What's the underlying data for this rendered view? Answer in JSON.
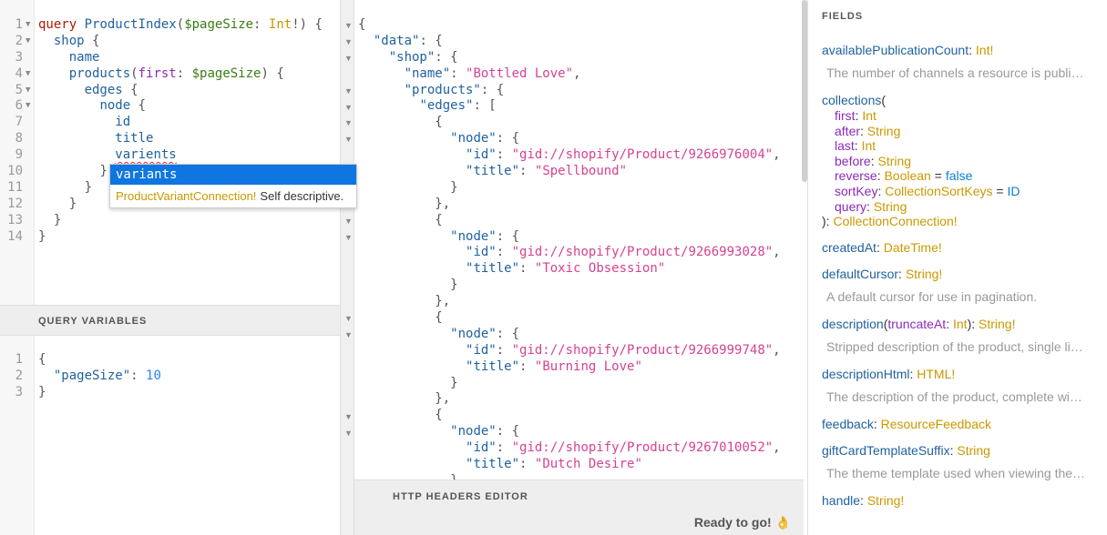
{
  "query_editor": {
    "lines": [
      {
        "n": "1",
        "fold": true
      },
      {
        "n": "2",
        "fold": true
      },
      {
        "n": "3",
        "fold": false
      },
      {
        "n": "4",
        "fold": true
      },
      {
        "n": "5",
        "fold": true
      },
      {
        "n": "6",
        "fold": true
      },
      {
        "n": "7",
        "fold": false
      },
      {
        "n": "8",
        "fold": false
      },
      {
        "n": "9",
        "fold": false
      },
      {
        "n": "10",
        "fold": false
      },
      {
        "n": "11",
        "fold": false
      },
      {
        "n": "12",
        "fold": false
      },
      {
        "n": "13",
        "fold": false
      },
      {
        "n": "14",
        "fold": false
      }
    ],
    "t1_kw": "query",
    "t1_name": "ProductIndex",
    "t1_open": "(",
    "t1_var": "$pageSize",
    "t1_colon": ": ",
    "t1_type": "Int",
    "t1_close": "!) {",
    "t2_field": "shop",
    "t2_brace": " {",
    "t3_field": "name",
    "t4_field": "products",
    "t4_open": "(",
    "t4_arg": "first",
    "t4_colon": ": ",
    "t4_var": "$pageSize",
    "t4_close": ") {",
    "t5_field": "edges",
    "t5_brace": " {",
    "t6_field": "node",
    "t6_brace": " {",
    "t7_field": "id",
    "t8_field": "title",
    "t9_field": "varients",
    "t10": "}",
    "t11": "}",
    "t12": "}",
    "t13": "}",
    "t14": "}"
  },
  "autocomplete": {
    "selected": "variants",
    "type": "ProductVariantConnection!",
    "description": "Self descriptive."
  },
  "variables": {
    "header": "QUERY VARIABLES",
    "l1": "{",
    "key": "\"pageSize\"",
    "colon": ": ",
    "value": "10",
    "l3": "}",
    "numbers": [
      "1",
      "2",
      "3"
    ]
  },
  "result": {
    "lines": [
      {
        "parts": [
          [
            "{",
            "pun"
          ]
        ],
        "fold": true
      },
      {
        "parts": [
          [
            "  ",
            ""
          ],
          [
            "\"data\"",
            "jkey"
          ],
          [
            ": {",
            "pun"
          ]
        ],
        "fold": true
      },
      {
        "parts": [
          [
            "    ",
            ""
          ],
          [
            "\"shop\"",
            "jkey"
          ],
          [
            ": {",
            "pun"
          ]
        ],
        "fold": true
      },
      {
        "parts": [
          [
            "      ",
            ""
          ],
          [
            "\"name\"",
            "jkey"
          ],
          [
            ": ",
            "pun"
          ],
          [
            "\"Bottled Love\"",
            "str"
          ],
          [
            ",",
            "pun"
          ]
        ],
        "fold": false
      },
      {
        "parts": [
          [
            "      ",
            ""
          ],
          [
            "\"products\"",
            "jkey"
          ],
          [
            ": {",
            "pun"
          ]
        ],
        "fold": true
      },
      {
        "parts": [
          [
            "        ",
            ""
          ],
          [
            "\"edges\"",
            "jkey"
          ],
          [
            ": [",
            "pun"
          ]
        ],
        "fold": true
      },
      {
        "parts": [
          [
            "          ",
            ""
          ],
          [
            "{",
            "pun"
          ]
        ],
        "fold": true
      },
      {
        "parts": [
          [
            "            ",
            ""
          ],
          [
            "\"node\"",
            "jkey"
          ],
          [
            ": {",
            "pun"
          ]
        ],
        "fold": true
      },
      {
        "parts": [
          [
            "              ",
            ""
          ],
          [
            "\"id\"",
            "jkey"
          ],
          [
            ": ",
            "pun"
          ],
          [
            "\"gid://shopify/Product/9266976004\"",
            "str"
          ],
          [
            ",",
            "pun"
          ]
        ],
        "fold": false
      },
      {
        "parts": [
          [
            "              ",
            ""
          ],
          [
            "\"title\"",
            "jkey"
          ],
          [
            ": ",
            "pun"
          ],
          [
            "\"Spellbound\"",
            "str"
          ]
        ],
        "fold": false
      },
      {
        "parts": [
          [
            "            ",
            ""
          ],
          [
            "}",
            "pun"
          ]
        ],
        "fold": false
      },
      {
        "parts": [
          [
            "          ",
            ""
          ],
          [
            "},",
            "pun"
          ]
        ],
        "fold": false
      },
      {
        "parts": [
          [
            "          ",
            ""
          ],
          [
            "{",
            "pun"
          ]
        ],
        "fold": true
      },
      {
        "parts": [
          [
            "            ",
            ""
          ],
          [
            "\"node\"",
            "jkey"
          ],
          [
            ": {",
            "pun"
          ]
        ],
        "fold": true
      },
      {
        "parts": [
          [
            "              ",
            ""
          ],
          [
            "\"id\"",
            "jkey"
          ],
          [
            ": ",
            "pun"
          ],
          [
            "\"gid://shopify/Product/9266993028\"",
            "str"
          ],
          [
            ",",
            "pun"
          ]
        ],
        "fold": false
      },
      {
        "parts": [
          [
            "              ",
            ""
          ],
          [
            "\"title\"",
            "jkey"
          ],
          [
            ": ",
            "pun"
          ],
          [
            "\"Toxic Obsession\"",
            "str"
          ]
        ],
        "fold": false
      },
      {
        "parts": [
          [
            "            ",
            ""
          ],
          [
            "}",
            "pun"
          ]
        ],
        "fold": false
      },
      {
        "parts": [
          [
            "          ",
            ""
          ],
          [
            "},",
            "pun"
          ]
        ],
        "fold": false
      },
      {
        "parts": [
          [
            "          ",
            ""
          ],
          [
            "{",
            "pun"
          ]
        ],
        "fold": true
      },
      {
        "parts": [
          [
            "            ",
            ""
          ],
          [
            "\"node\"",
            "jkey"
          ],
          [
            ": {",
            "pun"
          ]
        ],
        "fold": true
      },
      {
        "parts": [
          [
            "              ",
            ""
          ],
          [
            "\"id\"",
            "jkey"
          ],
          [
            ": ",
            "pun"
          ],
          [
            "\"gid://shopify/Product/9266999748\"",
            "str"
          ],
          [
            ",",
            "pun"
          ]
        ],
        "fold": false
      },
      {
        "parts": [
          [
            "              ",
            ""
          ],
          [
            "\"title\"",
            "jkey"
          ],
          [
            ": ",
            "pun"
          ],
          [
            "\"Burning Love\"",
            "str"
          ]
        ],
        "fold": false
      },
      {
        "parts": [
          [
            "            ",
            ""
          ],
          [
            "}",
            "pun"
          ]
        ],
        "fold": false
      },
      {
        "parts": [
          [
            "          ",
            ""
          ],
          [
            "},",
            "pun"
          ]
        ],
        "fold": false
      },
      {
        "parts": [
          [
            "          ",
            ""
          ],
          [
            "{",
            "pun"
          ]
        ],
        "fold": true
      },
      {
        "parts": [
          [
            "            ",
            ""
          ],
          [
            "\"node\"",
            "jkey"
          ],
          [
            ": {",
            "pun"
          ]
        ],
        "fold": true
      },
      {
        "parts": [
          [
            "              ",
            ""
          ],
          [
            "\"id\"",
            "jkey"
          ],
          [
            ": ",
            "pun"
          ],
          [
            "\"gid://shopify/Product/9267010052\"",
            "str"
          ],
          [
            ",",
            "pun"
          ]
        ],
        "fold": false
      },
      {
        "parts": [
          [
            "              ",
            ""
          ],
          [
            "\"title\"",
            "jkey"
          ],
          [
            ": ",
            "pun"
          ],
          [
            "\"Dutch Desire\"",
            "str"
          ]
        ],
        "fold": false
      },
      {
        "parts": [
          [
            "            ",
            ""
          ],
          [
            "}",
            "pun"
          ]
        ],
        "fold": false
      }
    ]
  },
  "headers_editor": {
    "title": "HTTP HEADERS EDITOR"
  },
  "status": {
    "text": "Ready to go! 👌"
  },
  "docs": {
    "title": "FIELDS",
    "fields": [
      {
        "name": "availablePublicationCount",
        "type": "Int!",
        "desc": "The number of channels a resource is publi…"
      },
      {
        "name": "collections",
        "args": [
          {
            "name": "first",
            "type": "Int"
          },
          {
            "name": "after",
            "type": "String"
          },
          {
            "name": "last",
            "type": "Int"
          },
          {
            "name": "before",
            "type": "String"
          },
          {
            "name": "reverse",
            "type": "Boolean",
            "default": "false"
          },
          {
            "name": "sortKey",
            "type": "CollectionSortKeys",
            "default": "ID"
          },
          {
            "name": "query",
            "type": "String"
          }
        ],
        "type": "CollectionConnection!"
      },
      {
        "name": "createdAt",
        "type": "DateTime!"
      },
      {
        "name": "defaultCursor",
        "type": "String!",
        "desc": "A default cursor for use in pagination."
      },
      {
        "name": "description",
        "inline_arg": {
          "name": "truncateAt",
          "type": "Int"
        },
        "type": "String!",
        "desc": "Stripped description of the product, single li…"
      },
      {
        "name": "descriptionHtml",
        "type": "HTML!",
        "desc": "The description of the product, complete wi…"
      },
      {
        "name": "feedback",
        "type": "ResourceFeedback"
      },
      {
        "name": "giftCardTemplateSuffix",
        "type": "String",
        "desc": "The theme template used when viewing the…"
      },
      {
        "name": "handle",
        "type": "String!"
      }
    ]
  }
}
